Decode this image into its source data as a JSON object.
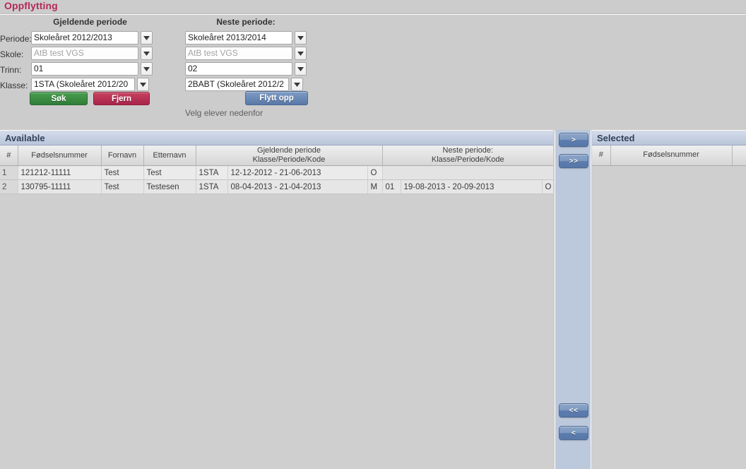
{
  "page": {
    "title": "Oppflytting",
    "hint": "Velg elever nedenfor"
  },
  "form": {
    "headers": {
      "current": "Gjeldende periode",
      "next": "Neste periode:"
    },
    "labels": {
      "periode": "Periode:",
      "skole": "Skole:",
      "trinn": "Trinn:",
      "klasse": "Klasse:"
    },
    "current_values": {
      "periode": "Skoleåret 2012/2013",
      "skole": "AtB test VGS",
      "trinn": "01",
      "klasse": "1STA (Skoleåret 2012/20"
    },
    "next_values": {
      "periode": "Skoleåret 2013/2014",
      "skole": "AtB test VGS",
      "trinn": "02",
      "klasse": "2BABT (Skoleåret 2012/2"
    },
    "buttons": {
      "search": "Søk",
      "remove": "Fjern",
      "move_up": "Flytt opp"
    }
  },
  "available": {
    "title": "Available",
    "columns": {
      "index": "#",
      "fodselsnummer": "Fødselsnummer",
      "fornavn": "Fornavn",
      "etternavn": "Etternavn",
      "current_line1": "Gjeldende periode",
      "current_line2": "Klasse/Periode/Kode",
      "next_line1": "Neste periode:",
      "next_line2": "Klasse/Periode/Kode"
    },
    "rows": [
      {
        "index": "1",
        "fodselsnummer": "121212-11111",
        "fornavn": "Test",
        "etternavn": "Test",
        "cur_klasse": "1STA",
        "cur_periode": "12-12-2012 - 21-06-2013",
        "cur_kode": "O",
        "next_klasse": "",
        "next_periode": "",
        "next_kode": ""
      },
      {
        "index": "2",
        "fodselsnummer": "130795-11111",
        "fornavn": "Test",
        "etternavn": "Testesen",
        "cur_klasse": "1STA",
        "cur_periode": "08-04-2013 - 21-04-2013",
        "cur_kode": "M",
        "next_klasse": "01",
        "next_periode": "19-08-2013 - 20-09-2013",
        "next_kode": "O"
      }
    ]
  },
  "transfer": {
    "add_one": ">",
    "add_all": ">>",
    "remove_all": "<<",
    "remove_one": "<"
  },
  "selected": {
    "title": "Selected",
    "columns": {
      "index": "#",
      "fodselsnummer": "Fødselsnummer",
      "extra": ""
    },
    "rows": []
  },
  "colors": {
    "title": "#b4295a",
    "panel_header": "#b9c5da",
    "search_button": "#2f7d38",
    "remove_button": "#a8254a",
    "move_button": "#5878a8",
    "transfer_bg": "#bcc8dc"
  }
}
